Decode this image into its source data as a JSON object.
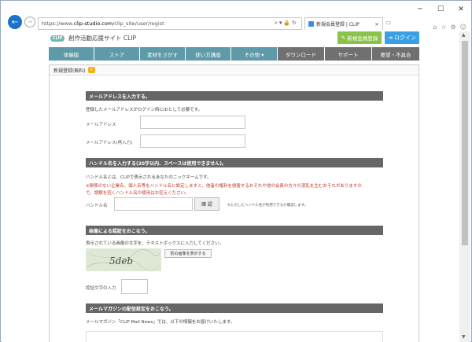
{
  "browser": {
    "url_prefix": "https://www.",
    "url_domain": "clip-studio.com",
    "url_path": "/clip_site/user/regist",
    "tab_title": "新規会員登録 | CLIP",
    "icons": {
      "back": "←",
      "forward": "→",
      "close_tab": "×",
      "new_tab": "▭",
      "home": "⌂",
      "star": "☆",
      "gear": "⚙",
      "smiley": "☺",
      "minimize": "─",
      "maximize": "☐",
      "close": "✕"
    }
  },
  "header": {
    "logo_mark": "CLIP",
    "site_name": "創作活動応援サイト CLIP",
    "register_label": "新規会員登録",
    "login_label": "ログイン"
  },
  "nav": {
    "items": [
      "体験版",
      "ストア",
      "素材をさがす",
      "使い方講座",
      "その他 ▾",
      "ダウンロード",
      "サポート",
      "要望・不具合"
    ]
  },
  "page": {
    "heading": "新規登録(無料)",
    "help_icon": "?",
    "sections": {
      "email": {
        "title": "メールアドレスを入力する。",
        "desc": "登録したメールアドレスがログイン時にIDとして必要です。",
        "label1": "メールアドレス",
        "label2": "メールアドレス(再入力)"
      },
      "handle": {
        "title": "ハンドル名を入力する(20字以内、スペースは使用できません)。",
        "desc": "ハンドル名とは、CLIPで表示されるあなたのニックネームです。",
        "warn1": "※関係のない企業名、個人名等をハンドル名に設定しますと、他者の権利を侵害するおそれや他の会員の方々の混乱を生むおそれがありますの",
        "warn2": "で、誤解を招くハンドル名の使用はお控えください。",
        "label": "ハンドル名",
        "check_label": "確 認",
        "note": "※入力したハンドル名が利用できるか確認します。"
      },
      "captcha": {
        "title": "画像による認証をおこなう。",
        "desc": "表示されている画像の文字を、テキストボックスに入力してください。",
        "image_text": "5deb",
        "refresh_label": "別の画像を表示する",
        "label": "認証文字の入力"
      },
      "mail": {
        "title": "メールマガジンの配信設定をおこなう。",
        "desc": "メールマガジン「CLIP Mail News」では、以下の情報をお届けいたします。"
      }
    }
  }
}
